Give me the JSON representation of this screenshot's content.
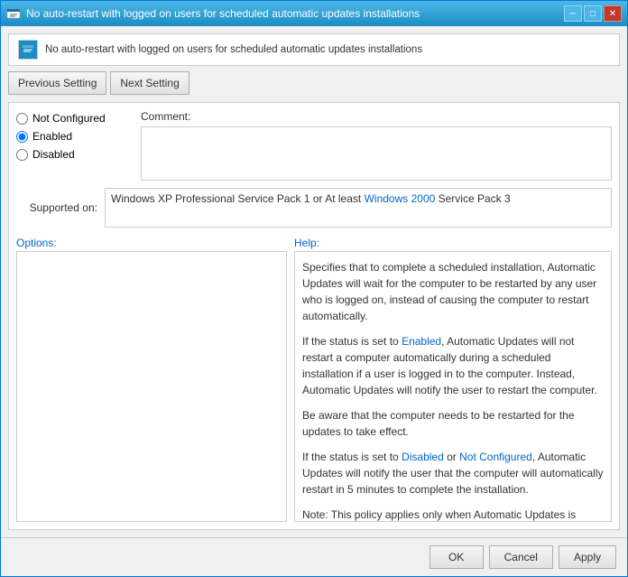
{
  "window": {
    "title": "No auto-restart with logged on users for scheduled automatic updates installations",
    "icon": "settings-icon"
  },
  "title_bar": {
    "minimize_label": "─",
    "maximize_label": "□",
    "close_label": "✕"
  },
  "header": {
    "banner_text": "No auto-restart with logged on users for scheduled automatic updates installations"
  },
  "nav": {
    "previous_label": "Previous Setting",
    "next_label": "Next Setting"
  },
  "radio": {
    "not_configured_label": "Not Configured",
    "enabled_label": "Enabled",
    "disabled_label": "Disabled",
    "selected": "enabled"
  },
  "comment": {
    "label": "Comment:",
    "value": ""
  },
  "supported": {
    "label": "Supported on:",
    "text": "Windows XP Professional Service Pack 1 or At least Windows 2000 Service Pack 3"
  },
  "sections": {
    "options_label": "Options:",
    "help_label": "Help:"
  },
  "help_text": {
    "p1": "Specifies that to complete a scheduled installation, Automatic Updates will wait for the computer to be restarted by any user who is logged on, instead of causing the computer to restart automatically.",
    "p2": "If the status is set to Enabled, Automatic Updates will not restart a computer automatically during a scheduled installation if a user is logged in to the computer. Instead, Automatic Updates will notify the user to restart the computer.",
    "p3": "Be aware that the computer needs to be restarted for the updates to take effect.",
    "p4": "If the status is set to Disabled or Not Configured, Automatic Updates will notify the user that the computer will automatically restart in 5 minutes to complete the installation.",
    "p5": "Note: This policy applies only when Automatic Updates is configured to perform scheduled installations of updates. If the"
  },
  "footer": {
    "ok_label": "OK",
    "cancel_label": "Cancel",
    "apply_label": "Apply"
  }
}
